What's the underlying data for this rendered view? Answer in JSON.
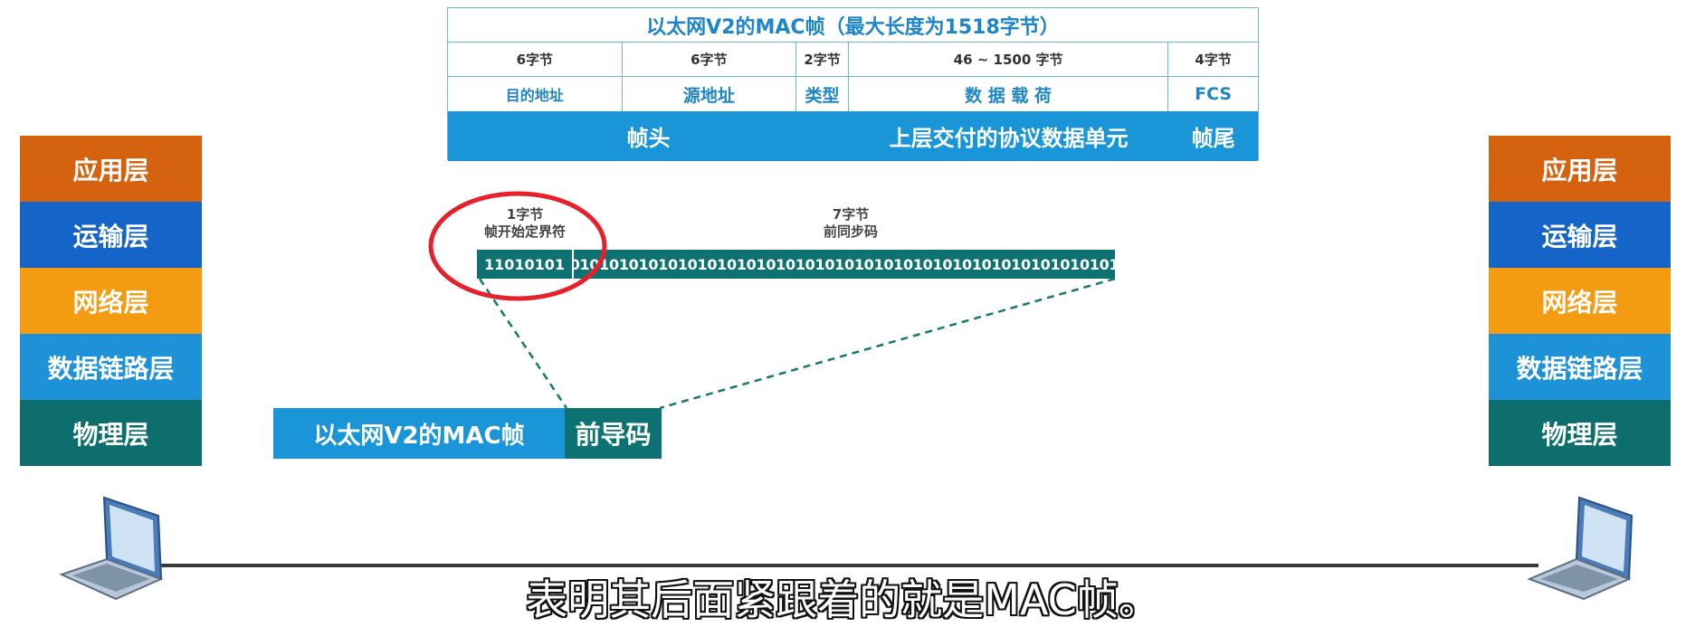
{
  "mac_frame": {
    "title": "以太网V2的MAC帧（最大长度为1518字节）",
    "bytes": [
      "6字节",
      "6字节",
      "2字节",
      "46 ~ 1500 字节",
      "4字节"
    ],
    "fields": [
      "目的地址",
      "源地址",
      "类型",
      "数 据 载 荷",
      "FCS"
    ],
    "bar": {
      "header": "帧头",
      "payload": "上层交付的协议数据单元",
      "trailer": "帧尾"
    }
  },
  "left_stack": {
    "layers": [
      "应用层",
      "运输层",
      "网络层",
      "数据链路层",
      "物理层"
    ]
  },
  "right_stack": {
    "layers": [
      "应用层",
      "运输层",
      "网络层",
      "数据链路层",
      "物理层"
    ]
  },
  "preamble": {
    "sfd_bytes": "1字节",
    "sfd_name": "帧开始定界符",
    "sfd_bits": "11010101",
    "sync_bytes": "7字节",
    "sync_name": "前同步码",
    "sync_bits": "01010101010101010101010101010101010101010101010101010101"
  },
  "frame_bar": {
    "main": "以太网V2的MAC帧",
    "pre": "前导码"
  },
  "subtitle": "表明其后面紧跟着的就是MAC帧。",
  "colors": {
    "blue": "#1a96d8",
    "teal": "#0f7272",
    "orange": "#d4620f",
    "amber": "#f39c12",
    "dark_blue": "#1565c8",
    "highlight_red": "#e8202a"
  }
}
